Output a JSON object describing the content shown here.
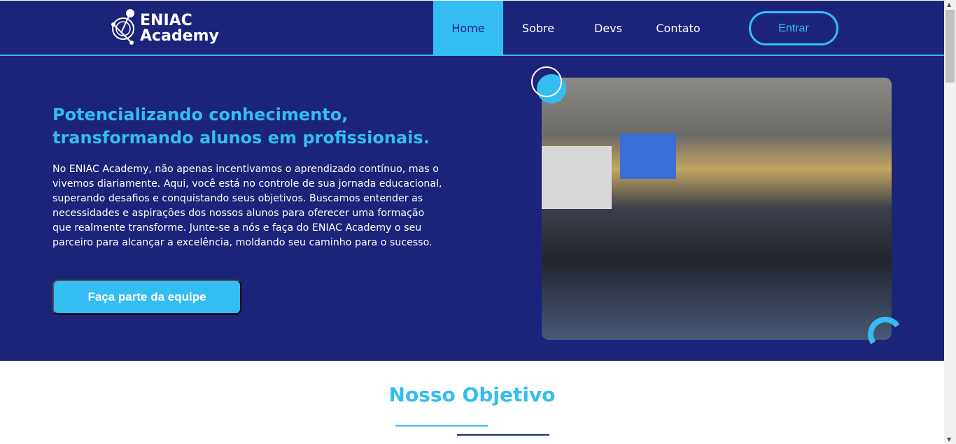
{
  "header": {
    "logo_line1": "ENIAC",
    "logo_line2": "Academy",
    "nav": [
      {
        "label": "Home",
        "active": true
      },
      {
        "label": "Sobre"
      },
      {
        "label": "Devs"
      },
      {
        "label": "Contato"
      }
    ],
    "enter_label": "Entrar"
  },
  "hero": {
    "title": "Potencializando conhecimento, transformando alunos em profissionais.",
    "text": "No ENIAC Academy, não apenas incentivamos o aprendizado contínuo, mas o vivemos diariamente. Aqui, você está no controle de sua jornada educacional, superando desafios e conquistando seus objetivos. Buscamos entender as necessidades e aspirações dos nossos alunos para oferecer uma formação que realmente transforme. Junte-se a nós e faça do ENIAC Academy o seu parceiro para alcançar a excelência, moldando seu caminho para o sucesso.",
    "cta_label": "Faça parte da equipe"
  },
  "objective": {
    "title": "Nosso Objetivo"
  },
  "colors": {
    "primary": "#1c247a",
    "accent": "#33bdf0"
  }
}
